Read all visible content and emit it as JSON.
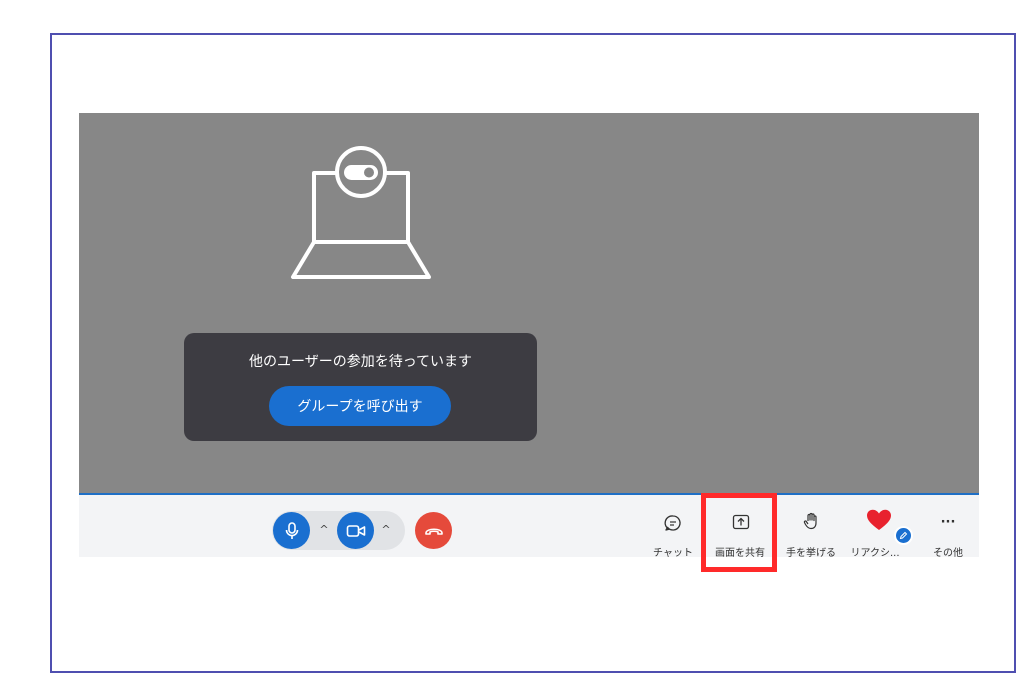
{
  "waiting": {
    "message": "他のユーザーの参加を待っています",
    "call_button": "グループを呼び出す"
  },
  "controls": {
    "mic_icon": "microphone-icon",
    "camera_icon": "video-camera-icon",
    "hangup_icon": "phone-hangup-icon",
    "mic_caret": "^",
    "camera_caret": "^"
  },
  "tools": {
    "chat": "チャット",
    "share_screen": "画面を共有",
    "raise_hand": "手を挙げる",
    "reactions": "リアクシ...",
    "more": "その他",
    "more_glyph": "···"
  },
  "colors": {
    "accent": "#1a6fd0",
    "hangup": "#e54a3b",
    "stage": "#878787",
    "highlight": "#ff2a2a",
    "heart": "#e8222e"
  }
}
